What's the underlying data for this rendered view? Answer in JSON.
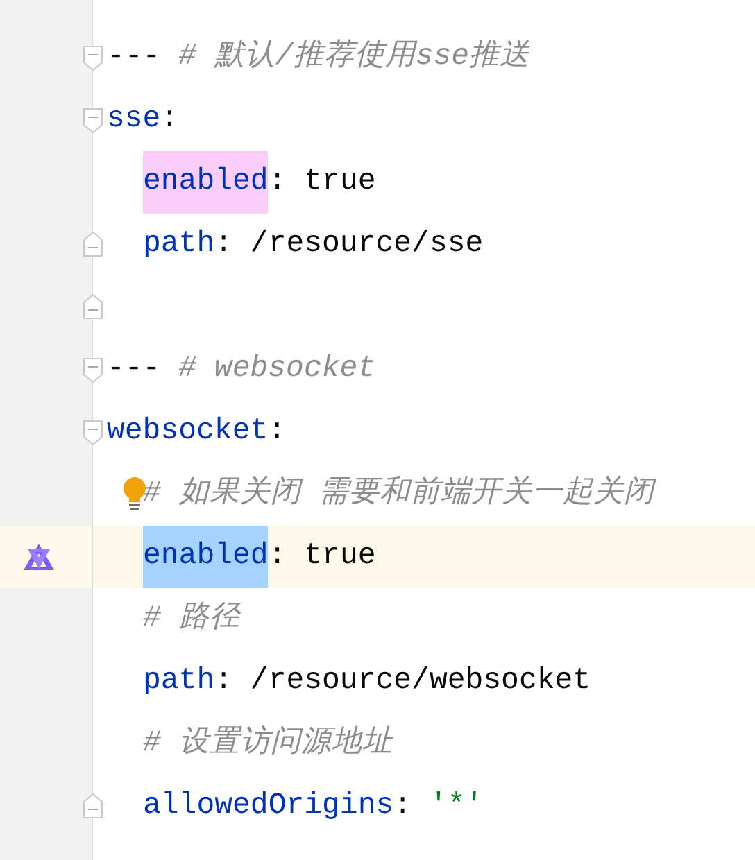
{
  "editor": {
    "lines": [
      {
        "indented": false,
        "fold_start": true,
        "current": false,
        "tokens": [
          {
            "kind": "separator",
            "text": "---"
          },
          {
            "kind": "comment",
            "text": "# 默认/推荐使用sse推送"
          }
        ]
      },
      {
        "indented": false,
        "fold_start": true,
        "current": false,
        "tokens": [
          {
            "kind": "key",
            "text": "sse"
          },
          {
            "kind": "punct",
            "text": ":"
          }
        ]
      },
      {
        "indented": true,
        "current": false,
        "tokens": [
          {
            "kind": "key",
            "text": "enabled",
            "color": "#fbcdfb"
          },
          {
            "kind": "punct",
            "text": ":"
          },
          {
            "kind": "value",
            "text": "true"
          }
        ]
      },
      {
        "indented": true,
        "fold_end": true,
        "current": false,
        "tokens": [
          {
            "kind": "key",
            "text": "path"
          },
          {
            "kind": "punct",
            "text": ":"
          },
          {
            "kind": "value",
            "text": "/resource/sse"
          }
        ]
      },
      {
        "fold_end": true,
        "current": false
      },
      {
        "indented": false,
        "fold_start": true,
        "current": false,
        "tokens": [
          {
            "kind": "separator",
            "text": "---"
          },
          {
            "kind": "comment",
            "text": "# websocket"
          }
        ]
      },
      {
        "indented": false,
        "fold_start": true,
        "current": false,
        "tokens": [
          {
            "kind": "key",
            "text": "websocket"
          },
          {
            "kind": "punct",
            "text": ":"
          }
        ]
      },
      {
        "indented": true,
        "bulb": true,
        "current": false,
        "tokens": [
          {
            "kind": "comment",
            "text": "# 如果关闭 需要和前端开关一起关闭"
          }
        ]
      },
      {
        "indented": true,
        "current": true,
        "ai_icon": true,
        "tokens": [
          {
            "kind": "key",
            "text": "enabled",
            "color": "#a6d2ff"
          },
          {
            "kind": "punct",
            "text": ":"
          },
          {
            "kind": "value",
            "text": "true"
          }
        ]
      },
      {
        "indented": true,
        "current": false,
        "tokens": [
          {
            "kind": "comment",
            "text": "# 路径"
          }
        ]
      },
      {
        "indented": true,
        "current": false,
        "tokens": [
          {
            "kind": "key",
            "text": "path"
          },
          {
            "kind": "punct",
            "text": ":"
          },
          {
            "kind": "value",
            "text": "/resource/websocket"
          }
        ]
      },
      {
        "indented": true,
        "current": false,
        "tokens": [
          {
            "kind": "comment",
            "text": "# 设置访问源地址"
          }
        ]
      },
      {
        "indented": true,
        "fold_end": true,
        "current": false,
        "tokens": [
          {
            "kind": "key",
            "text": "allowedOrigins"
          },
          {
            "kind": "punct",
            "text": ":"
          },
          {
            "kind": "string",
            "text": "'*'"
          }
        ]
      }
    ]
  }
}
